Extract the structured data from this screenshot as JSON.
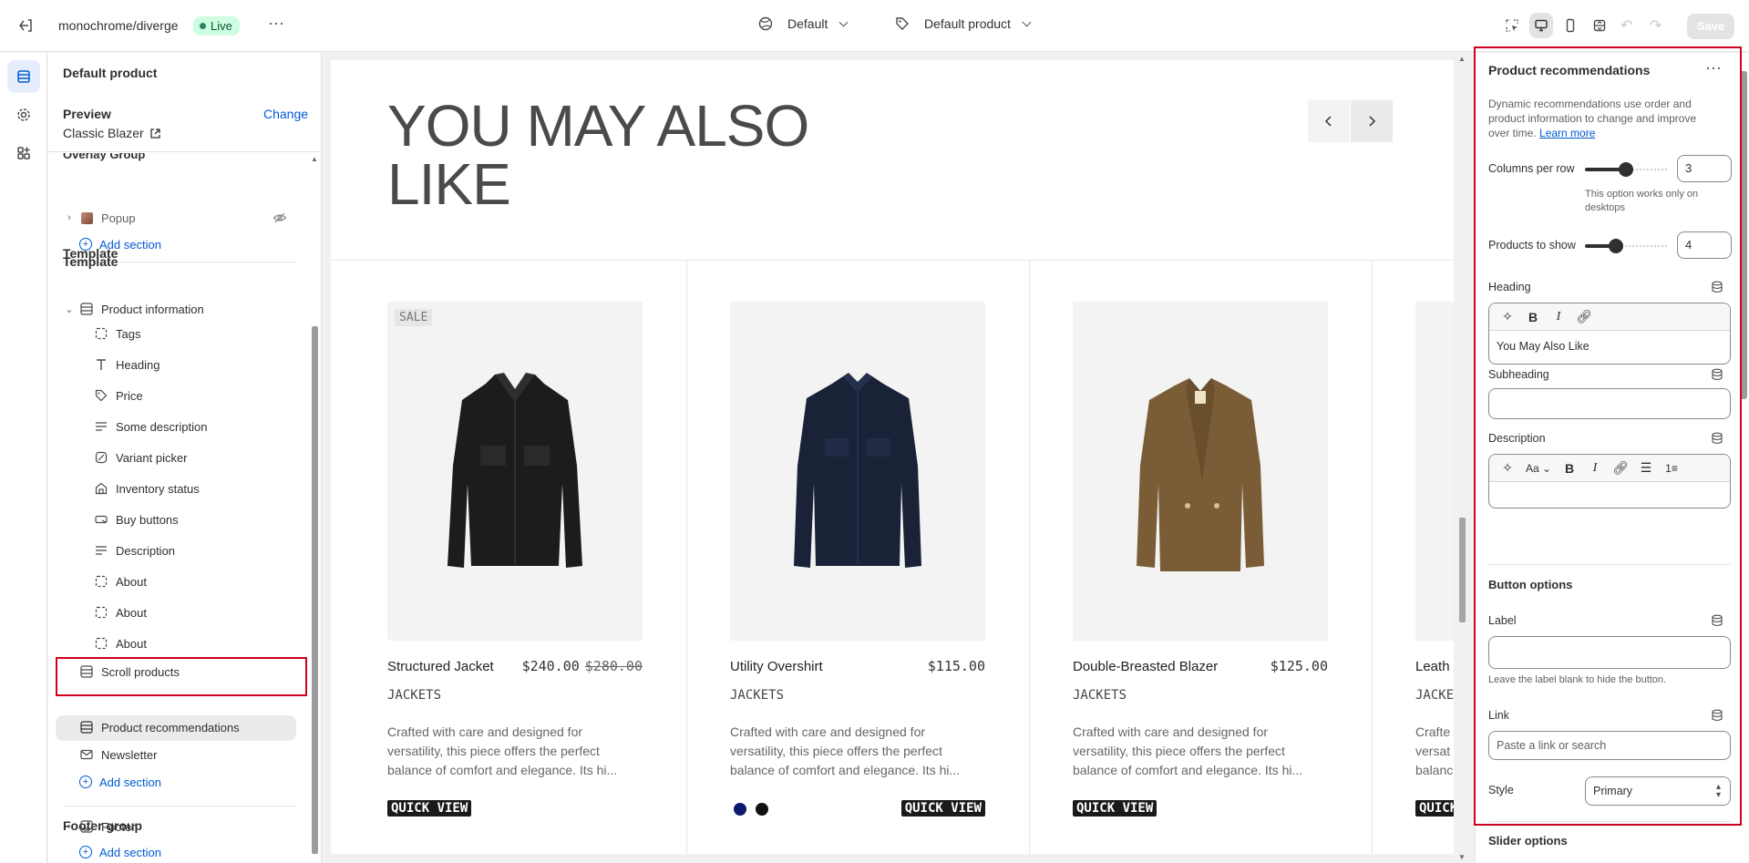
{
  "topbar": {
    "store_name": "monochrome/diverge",
    "live_badge": "Live",
    "theme_selector": "Default",
    "template_selector": "Default product",
    "save_label": "Save"
  },
  "sidebar": {
    "title": "Default product",
    "preview_label": "Preview",
    "change_label": "Change",
    "preview_value": "Classic Blazer",
    "overlay_group_label": "Overlay Group",
    "popup_label": "Popup",
    "add_section": "Add section",
    "template_label": "Template",
    "product_information": "Product information",
    "blocks": [
      "Tags",
      "Heading",
      "Price",
      "Some description",
      "Variant picker",
      "Inventory status",
      "Buy buttons",
      "Description",
      "About",
      "About",
      "About"
    ],
    "scroll_products": "Scroll products",
    "product_recommendations": "Product recommendations",
    "newsletter": "Newsletter",
    "footer_group_label": "Footer group",
    "footer": "Footer"
  },
  "preview": {
    "heading_line1": "YOU MAY ALSO",
    "heading_line2": "LIKE",
    "products": [
      {
        "name": "Structured Jacket",
        "price": "$240.00",
        "compare_price": "$280.00",
        "badge": "SALE",
        "category": "JACKETS",
        "desc_1": "Crafted with care and designed for",
        "desc_2": "versatility, this piece offers the perfect",
        "desc_3": "balance of comfort and elegance. Its hi...",
        "quick_view": "QUICK VIEW"
      },
      {
        "name": "Utility Overshirt",
        "price": "$115.00",
        "category": "JACKETS",
        "desc_1": "Crafted with care and designed for",
        "desc_2": "versatility, this piece offers the perfect",
        "desc_3": "balance of comfort and elegance. Its hi...",
        "quick_view": "QUICK VIEW",
        "swatches": [
          "#0d1b6e",
          "#111111"
        ]
      },
      {
        "name": "Double-Breasted Blazer",
        "price": "$125.00",
        "category": "JACKETS",
        "desc_1": "Crafted with care and designed for",
        "desc_2": "versatility, this piece offers the perfect",
        "desc_3": "balance of comfort and elegance. Its hi...",
        "quick_view": "QUICK VIEW"
      },
      {
        "name": "Leath",
        "category": "JACKE",
        "desc_1": "Crafte",
        "desc_2": "versat",
        "desc_3": "balanc",
        "quick_view": "QUICK"
      }
    ]
  },
  "settings": {
    "title": "Product recommendations",
    "help_text": "Dynamic recommendations use order and product information to change and improve over time.",
    "learn_more": "Learn more",
    "columns_label": "Columns per row",
    "columns_value": "3",
    "columns_slider_fraction": 0.5,
    "columns_hint": "This option works only on desktops",
    "products_label": "Products to show",
    "products_value": "4",
    "products_slider_fraction": 0.35,
    "heading_label": "Heading",
    "heading_value": "You May Also Like",
    "subheading_label": "Subheading",
    "description_label": "Description",
    "button_options": "Button options",
    "label_label": "Label",
    "label_hint": "Leave the label blank to hide the button.",
    "link_label": "Link",
    "link_placeholder": "Paste a link or search",
    "style_label": "Style",
    "style_value": "Primary",
    "slider_options": "Slider options"
  },
  "colors": {
    "accent": "#005bd3",
    "live_bg": "#cdfee1",
    "highlight": "#d0021b"
  }
}
